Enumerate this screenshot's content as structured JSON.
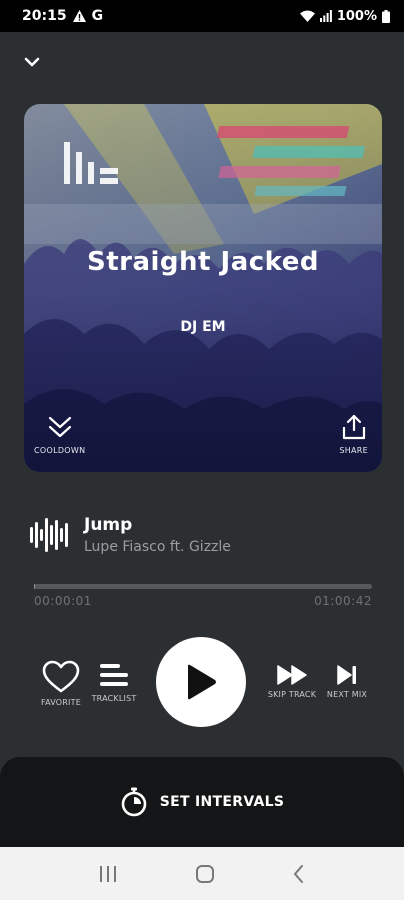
{
  "status_bar": {
    "time": "20:15",
    "carrier": "G",
    "battery": "100%"
  },
  "mix": {
    "title": "Straight Jacked",
    "dj": "DJ EM"
  },
  "artwork_actions": {
    "cooldown_label": "COOLDOWN",
    "share_label": "SHARE"
  },
  "track": {
    "name": "Jump",
    "artist": "Lupe Fiasco ft. Gizzle"
  },
  "playback": {
    "elapsed": "00:00:01",
    "total": "01:00:42",
    "progress": 0.0003
  },
  "controls": {
    "favorite_label": "FAVORITE",
    "tracklist_label": "TRACKLIST",
    "skip_track_label": "SKIP TRACK",
    "next_mix_label": "NEXT MIX"
  },
  "intervals": {
    "label": "SET INTERVALS"
  },
  "colors": {
    "background": "#2c2f31",
    "panel": "#141516",
    "accent": "#ffffff"
  }
}
